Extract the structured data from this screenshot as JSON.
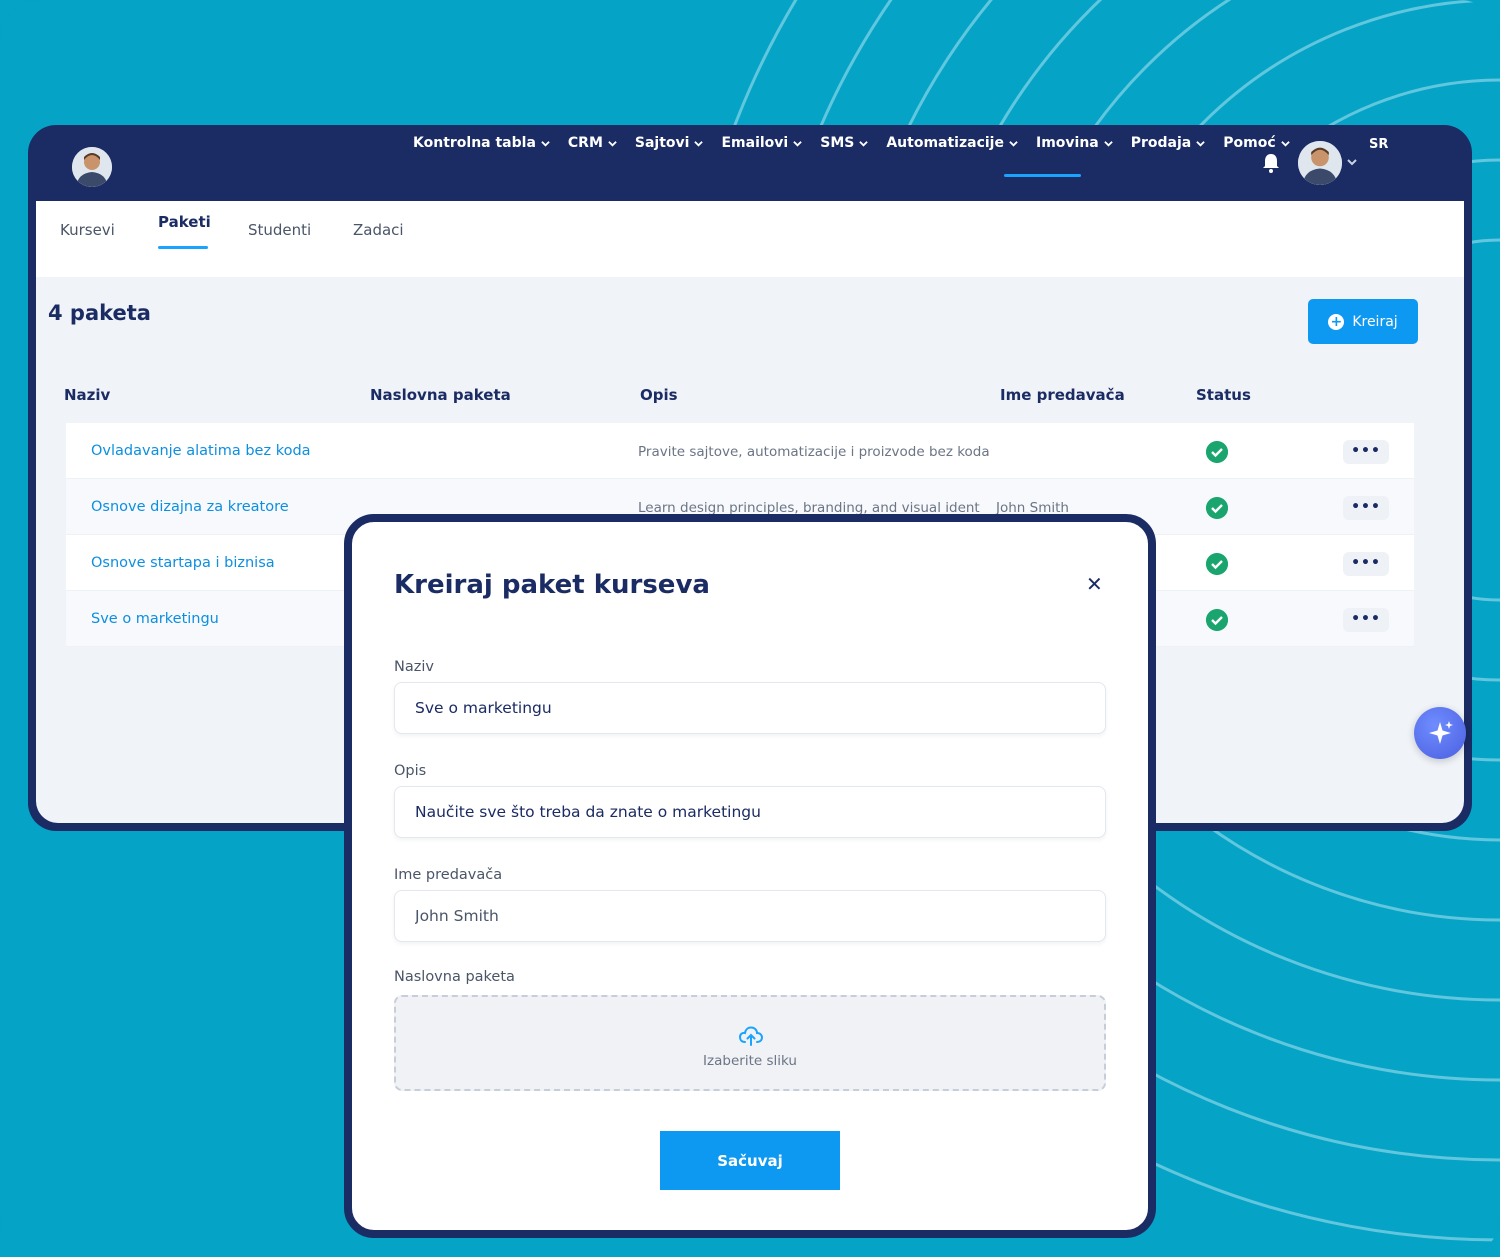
{
  "nav": {
    "items": [
      {
        "label": "Kontrolna tabla"
      },
      {
        "label": "CRM"
      },
      {
        "label": "Sajtovi"
      },
      {
        "label": "Emailovi"
      },
      {
        "label": "SMS"
      },
      {
        "label": "Automatizacije"
      },
      {
        "label": "Imovina"
      },
      {
        "label": "Prodaja"
      },
      {
        "label": "Pomoć"
      }
    ],
    "active": "Imovina",
    "language": "SR"
  },
  "tabs": [
    {
      "label": "Kursevi"
    },
    {
      "label": "Paketi"
    },
    {
      "label": "Studenti"
    },
    {
      "label": "Zadaci"
    }
  ],
  "active_tab": "Paketi",
  "page": {
    "title": "4 paketa",
    "create_button": "Kreiraj"
  },
  "table": {
    "headers": {
      "name": "Naziv",
      "cover": "Naslovna paketa",
      "description": "Opis",
      "instructor": "Ime predavača",
      "status": "Status"
    },
    "rows": [
      {
        "name": "Ovladavanje alatima bez koda",
        "description": "Pravite sajtove, automatizacije i proizvode bez koda",
        "instructor": "",
        "status": "active"
      },
      {
        "name": "Osnove dizajna za kreatore",
        "description": "Learn design principles, branding, and visual ident",
        "instructor": "John Smith",
        "status": "active"
      },
      {
        "name": "Osnove startapa i biznisa",
        "description": "",
        "instructor": "",
        "status": "active"
      },
      {
        "name": "Sve o marketingu",
        "description": "",
        "instructor": "",
        "status": "active"
      }
    ],
    "more_label": "•••"
  },
  "modal": {
    "title": "Kreiraj paket kurseva",
    "close": "✕",
    "fields": {
      "name_label": "Naziv",
      "name_value": "Sve o marketingu",
      "description_label": "Opis",
      "description_value": "Naučite sve što treba da znate o marketingu",
      "instructor_label": "Ime predavača",
      "instructor_value": "John Smith",
      "cover_label": "Naslovna paketa",
      "upload_text": "Izaberite sliku"
    },
    "save_button": "Sačuvaj"
  },
  "colors": {
    "background": "#05a3c6",
    "navy": "#1b2b63",
    "primary": "#0d99f2",
    "success": "#1aa56e"
  }
}
